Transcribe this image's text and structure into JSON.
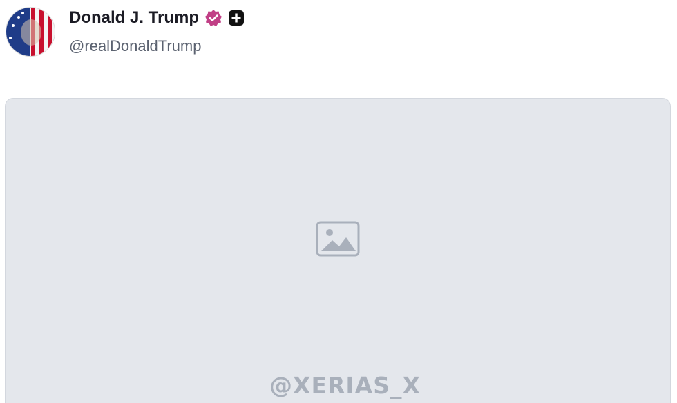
{
  "author": {
    "display_name": "Donald J. Trump",
    "handle": "@realDonaldTrump",
    "avatar_icon": "flag-portrait-avatar",
    "verified_icon": "verified-badge-icon",
    "verified_color": "#c13f86",
    "plus_icon": "plus-square-icon"
  },
  "media": {
    "icon": "image-icon",
    "watermark": "@XERIAS_X"
  }
}
